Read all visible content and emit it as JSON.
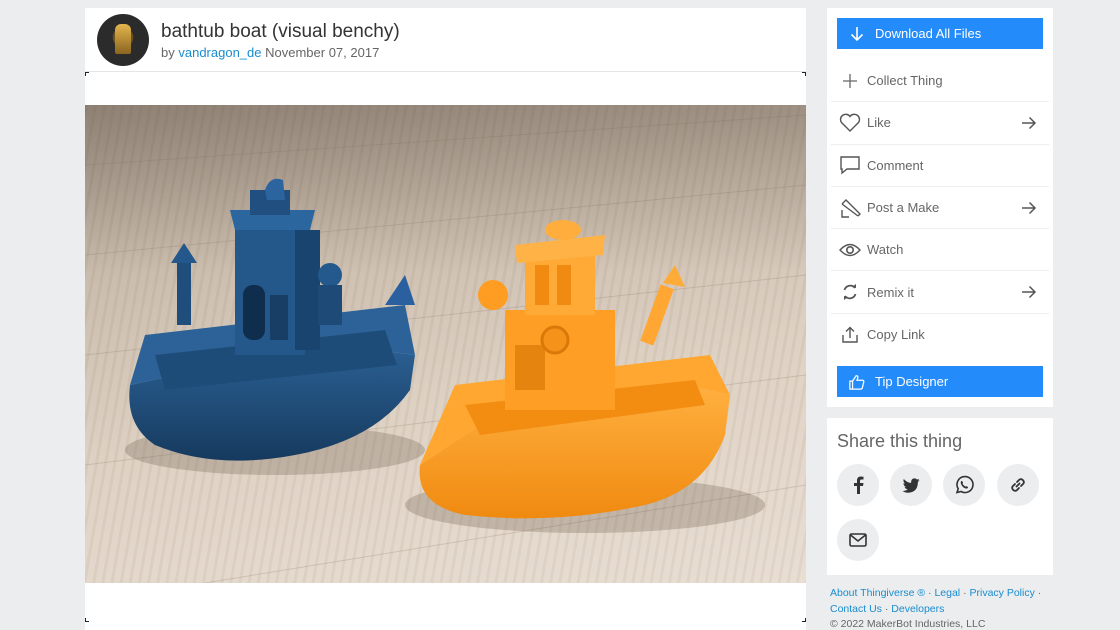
{
  "thing": {
    "title": "bathtub boat (visual benchy)",
    "by_prefix": "by",
    "author": "vandragon_de",
    "date": "November 07, 2017"
  },
  "actions": {
    "download_label": "Download All Files",
    "collect_label": "Collect Thing",
    "like_label": "Like",
    "comment_label": "Comment",
    "post_make_label": "Post a Make",
    "watch_label": "Watch",
    "remix_label": "Remix it",
    "copy_link_label": "Copy Link",
    "tip_label": "Tip Designer"
  },
  "share": {
    "title": "Share this thing",
    "buttons": [
      "facebook-icon",
      "twitter-icon",
      "whatsapp-icon",
      "link-icon",
      "email-icon"
    ]
  },
  "footer": {
    "about": "About Thingiverse ®",
    "legal": "Legal",
    "privacy": "Privacy Policy",
    "contact": "Contact Us",
    "developers": "Developers",
    "copyright": "© 2022 MakerBot Industries, LLC",
    "separator": "·"
  },
  "colors": {
    "accent": "#248bfb",
    "link": "#1a8cce",
    "page_bg": "#ebedef",
    "boat_blue": "#1f4e7a",
    "boat_orange": "#ff9a1f"
  }
}
